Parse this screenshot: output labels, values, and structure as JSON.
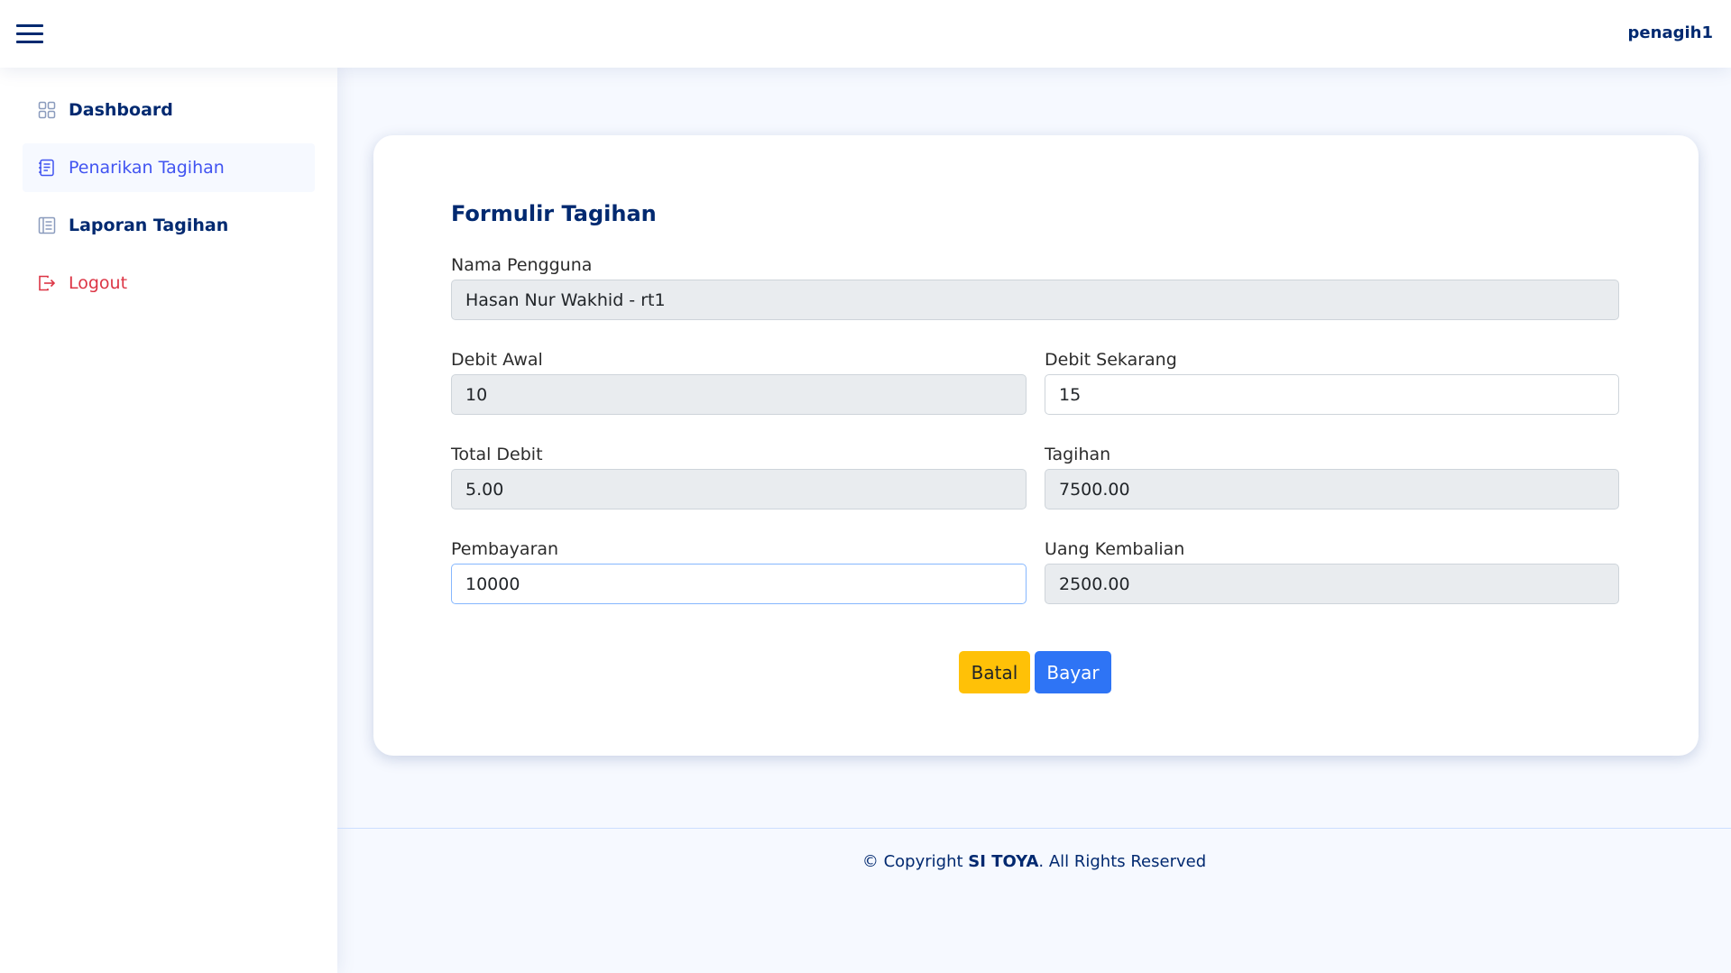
{
  "header": {
    "username": "penagih1"
  },
  "sidebar": {
    "items": [
      {
        "label": "Dashboard",
        "icon": "grid-icon"
      },
      {
        "label": "Penarikan Tagihan",
        "icon": "journal-icon"
      },
      {
        "label": "Laporan Tagihan",
        "icon": "list-icon"
      },
      {
        "label": "Logout",
        "icon": "logout-icon"
      }
    ]
  },
  "form": {
    "title": "Formulir Tagihan",
    "nama_pengguna": {
      "label": "Nama Pengguna",
      "value": "Hasan Nur Wakhid - rt1"
    },
    "debit_awal": {
      "label": "Debit Awal",
      "value": "10"
    },
    "debit_sekarang": {
      "label": "Debit Sekarang",
      "value": "15"
    },
    "total_debit": {
      "label": "Total Debit",
      "value": "5.00"
    },
    "tagihan": {
      "label": "Tagihan",
      "value": "7500.00"
    },
    "pembayaran": {
      "label": "Pembayaran",
      "value": "10000"
    },
    "uang_kembalian": {
      "label": "Uang Kembalian",
      "value": "2500.00"
    },
    "cancel_label": "Batal",
    "pay_label": "Bayar"
  },
  "footer": {
    "prefix": "© Copyright ",
    "brand": "SI TOYA",
    "suffix": ". All Rights Reserved"
  },
  "colors": {
    "primary": "#012970",
    "active": "#4154f1",
    "logout": "#dc3545",
    "cancel_button": "#ffc107",
    "pay_button": "#2e74f5"
  }
}
